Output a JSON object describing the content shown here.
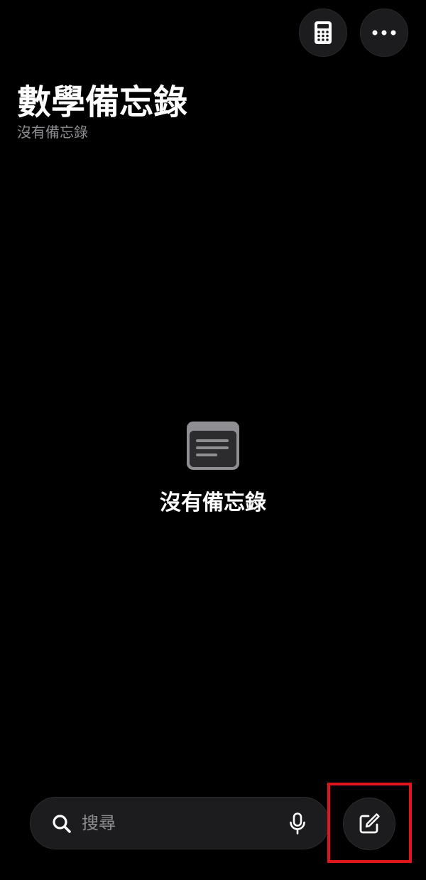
{
  "header": {
    "title": "數學備忘錄",
    "subtitle": "沒有備忘錄",
    "calculator_icon": "calculator-icon",
    "more_icon": "ellipsis-icon"
  },
  "empty_state": {
    "icon": "note-icon",
    "message": "沒有備忘錄"
  },
  "bottom_bar": {
    "search_placeholder": "搜尋",
    "search_icon": "search-icon",
    "mic_icon": "microphone-icon",
    "compose_icon": "compose-icon"
  },
  "colors": {
    "background": "#000000",
    "button_bg": "#1c1c1e",
    "secondary_text": "#8e8e93",
    "highlight": "#e0161c"
  }
}
